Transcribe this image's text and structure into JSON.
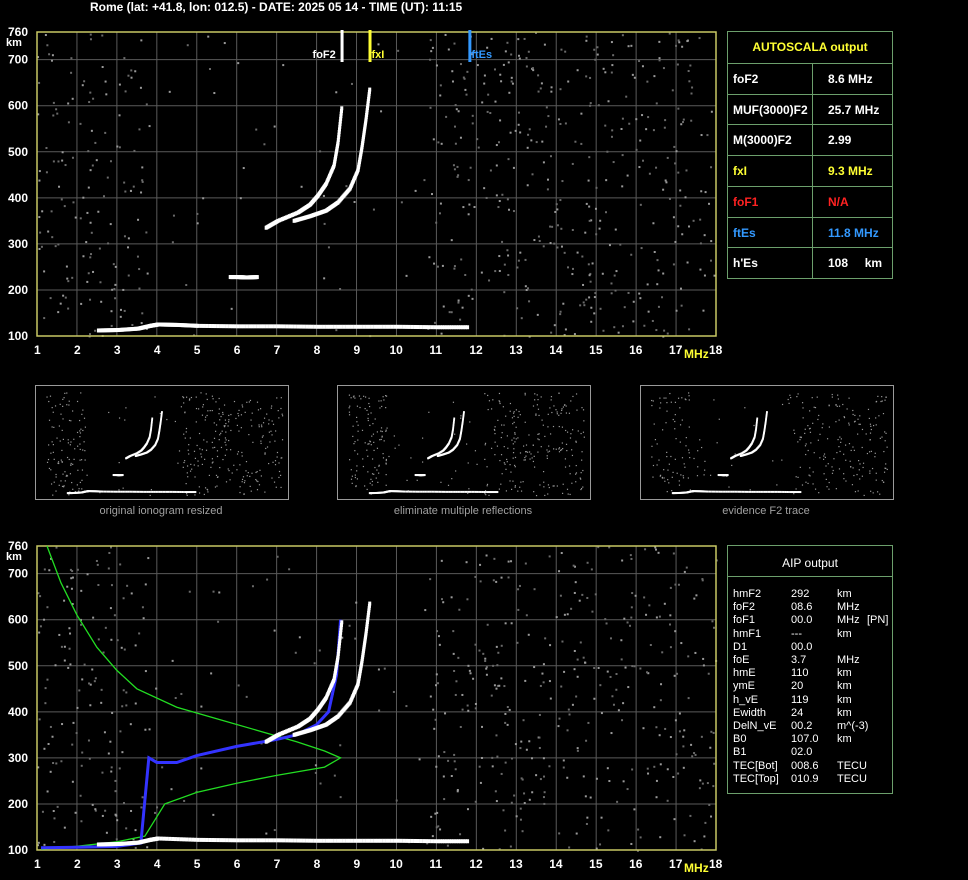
{
  "header": "Rome (lat: +41.8, lon: 012.5) - DATE: 2025 05 14 - TIME (UT): 11:15",
  "axes": {
    "y_ticks": [
      "760",
      "700",
      "600",
      "500",
      "400",
      "300",
      "200",
      "100"
    ],
    "y_unit": "km",
    "x_ticks": [
      "1",
      "2",
      "3",
      "4",
      "5",
      "6",
      "7",
      "8",
      "9",
      "10",
      "11",
      "12",
      "13",
      "14",
      "15",
      "16",
      "17",
      "18"
    ],
    "x_unit": "MHz"
  },
  "markers": [
    {
      "label": "foF2",
      "freq": 8.6,
      "color": "#ffffff"
    },
    {
      "label": "fxI",
      "freq": 9.3,
      "color": "#ffff33"
    },
    {
      "label": "ftEs",
      "freq": 11.8,
      "color": "#3399ff"
    }
  ],
  "autoscala": {
    "title": "AUTOSCALA output",
    "rows": [
      {
        "label": "foF2",
        "value": "8.6 MHz",
        "color": "#ffffff"
      },
      {
        "label": "MUF(3000)F2",
        "value": "25.7 MHz",
        "color": "#ffffff"
      },
      {
        "label": "M(3000)F2",
        "value": "2.99",
        "color": "#ffffff"
      },
      {
        "label": "fxI",
        "value": "9.3 MHz",
        "color": "#ffff33"
      },
      {
        "label": "foF1",
        "value": "N/A",
        "color": "#ff2222"
      },
      {
        "label": "ftEs",
        "value": "11.8 MHz",
        "color": "#3399ff"
      },
      {
        "label": "h'Es",
        "value": "108     km",
        "color": "#ffffff"
      }
    ]
  },
  "thumbnails": [
    {
      "caption": "original ionogram resized"
    },
    {
      "caption": "eliminate multiple reflections"
    },
    {
      "caption": "evidence F2 trace"
    }
  ],
  "aip": {
    "title": "AIP output",
    "rows": [
      {
        "name": "hmF2",
        "value": "292",
        "unit": "km",
        "extra": ""
      },
      {
        "name": "foF2",
        "value": "08.6",
        "unit": "MHz",
        "extra": ""
      },
      {
        "name": "foF1",
        "value": "00.0",
        "unit": "MHz",
        "extra": "[PN]"
      },
      {
        "name": "hmF1",
        "value": "---",
        "unit": "km",
        "extra": ""
      },
      {
        "name": "D1",
        "value": "00.0",
        "unit": "",
        "extra": ""
      },
      {
        "name": "foE",
        "value": "3.7",
        "unit": "MHz",
        "extra": ""
      },
      {
        "name": "hmE",
        "value": "110",
        "unit": "km",
        "extra": ""
      },
      {
        "name": "ymE",
        "value": "20",
        "unit": "km",
        "extra": ""
      },
      {
        "name": "h_vE",
        "value": "119",
        "unit": "km",
        "extra": ""
      },
      {
        "name": "Ewidth",
        "value": "24",
        "unit": "km",
        "extra": ""
      },
      {
        "name": "DelN_vE",
        "value": "00.2",
        "unit": "m^(-3)",
        "extra": ""
      },
      {
        "name": "B0",
        "value": "107.0",
        "unit": "km",
        "extra": ""
      },
      {
        "name": "B1",
        "value": "02.0",
        "unit": "",
        "extra": ""
      },
      {
        "name": "TEC[Bot]",
        "value": "008.6",
        "unit": "TECU",
        "extra": ""
      },
      {
        "name": "TEC[Top]",
        "value": "010.9",
        "unit": "TECU",
        "extra": ""
      }
    ]
  },
  "chart_data": [
    {
      "type": "scatter",
      "title": "",
      "xlabel": "MHz",
      "ylabel": "km",
      "xlim": [
        1,
        18
      ],
      "ylim": [
        100,
        760
      ],
      "grid": true,
      "series": [
        {
          "name": "E/Es trace",
          "color": "#ffffff",
          "x": [
            2.5,
            3.0,
            3.5,
            3.8,
            4.0,
            4.5,
            5.0,
            6.0,
            7.0,
            8.0,
            9.0,
            10.0,
            11.0,
            11.8
          ],
          "y": [
            112,
            113,
            116,
            122,
            125,
            124,
            122,
            121,
            121,
            120,
            120,
            120,
            119,
            119
          ]
        },
        {
          "name": "F2 ordinary",
          "color": "#ffffff",
          "x": [
            6.7,
            7.0,
            7.5,
            7.8,
            8.0,
            8.2,
            8.4,
            8.5,
            8.6
          ],
          "y": [
            335,
            350,
            368,
            385,
            405,
            430,
            470,
            520,
            600
          ]
        },
        {
          "name": "F2 extraordinary",
          "color": "#ffffff",
          "x": [
            7.4,
            7.8,
            8.2,
            8.5,
            8.8,
            9.0,
            9.1,
            9.2,
            9.3
          ],
          "y": [
            350,
            360,
            372,
            390,
            420,
            460,
            510,
            570,
            640
          ]
        },
        {
          "name": "Es patch",
          "color": "#ffffff",
          "x": [
            5.8,
            6.0,
            6.2,
            6.5
          ],
          "y": [
            228,
            228,
            227,
            228
          ]
        }
      ]
    },
    {
      "type": "line",
      "title": "",
      "xlabel": "MHz",
      "ylabel": "km",
      "xlim": [
        1,
        18
      ],
      "ylim": [
        100,
        760
      ],
      "grid": true,
      "series": [
        {
          "name": "electron density profile",
          "color": "#22dd22",
          "x": [
            1.25,
            1.6,
            2.0,
            2.5,
            3.0,
            3.5,
            4.5,
            5.5,
            6.5,
            7.5,
            8.2,
            8.6,
            8.2,
            7.0,
            6.0,
            5.0,
            4.2,
            3.7,
            3.0,
            2.0,
            1.1
          ],
          "y": [
            760,
            680,
            610,
            540,
            490,
            450,
            410,
            385,
            360,
            335,
            315,
            300,
            280,
            262,
            245,
            225,
            200,
            130,
            118,
            108,
            102
          ]
        },
        {
          "name": "true height trace",
          "color": "#3333ff",
          "x": [
            1.1,
            2.0,
            3.0,
            3.6,
            3.8,
            4.0,
            4.5,
            5.0,
            6.0,
            7.0,
            7.5,
            8.0,
            8.3,
            8.5,
            8.6
          ],
          "y": [
            105,
            106,
            108,
            115,
            300,
            290,
            290,
            305,
            325,
            340,
            350,
            372,
            400,
            480,
            600
          ]
        },
        {
          "name": "E/Es trace",
          "color": "#ffffff",
          "x": [
            2.5,
            3.0,
            3.5,
            3.8,
            4.0,
            5.0,
            6.0,
            7.0,
            8.0,
            9.0,
            10.0,
            11.0,
            11.8
          ],
          "y": [
            112,
            113,
            116,
            122,
            125,
            122,
            121,
            121,
            120,
            120,
            120,
            119,
            119
          ]
        },
        {
          "name": "F2 ordinary",
          "color": "#ffffff",
          "x": [
            6.7,
            7.0,
            7.5,
            7.8,
            8.0,
            8.2,
            8.4,
            8.5,
            8.6
          ],
          "y": [
            335,
            350,
            368,
            385,
            405,
            430,
            470,
            520,
            600
          ]
        },
        {
          "name": "F2 extraordinary",
          "color": "#ffffff",
          "x": [
            7.4,
            7.8,
            8.2,
            8.5,
            8.8,
            9.0,
            9.1,
            9.2,
            9.3
          ],
          "y": [
            350,
            360,
            372,
            390,
            420,
            460,
            510,
            570,
            640
          ]
        }
      ]
    }
  ]
}
